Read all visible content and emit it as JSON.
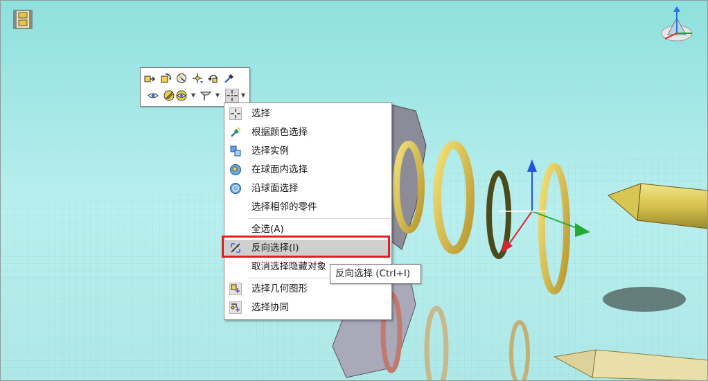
{
  "toolbar": {
    "row1_icons": [
      "move-component-icon",
      "rotate-component-icon",
      "selection-filter-icon",
      "smart-mate-icon",
      "undo-rotate-icon",
      "color-picker-icon"
    ],
    "row2_icons": [
      "show-hide-eye-icon",
      "hide-show-toggle-icon",
      "appearance-eye-icon",
      "section-view-icon",
      "select-tool-icon"
    ]
  },
  "menu": {
    "items": [
      {
        "label": "选择",
        "icon": "select-cursor-icon"
      },
      {
        "label": "根据颜色选择",
        "icon": "color-select-icon"
      },
      {
        "label": "选择实例",
        "icon": "instances-select-icon"
      },
      {
        "label": "在球面内选择",
        "icon": "sphere-inside-icon"
      },
      {
        "label": "沿球面选择",
        "icon": "sphere-along-icon"
      },
      {
        "label": "选择相邻的零件",
        "icon": ""
      },
      {
        "label": "全选(A)",
        "icon": ""
      },
      {
        "label": "反向选择(I)",
        "icon": "invert-selection-icon",
        "highlighted": true
      },
      {
        "label": "取消选择隐藏对象",
        "icon": ""
      },
      {
        "label": "选择几何图形",
        "icon": "geometry-select-icon"
      },
      {
        "label": "选择协同",
        "icon": "mates-select-icon"
      }
    ]
  },
  "tooltip": {
    "text": "反向选择 (Ctrl+I)"
  },
  "colors": {
    "background": "#9fe6e4",
    "highlight_frame": "#e02020",
    "menu_hover": "#cfcfcf"
  }
}
